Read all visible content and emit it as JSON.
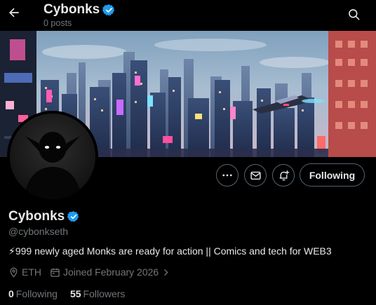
{
  "header": {
    "title": "Cybonks",
    "post_count": "0 posts"
  },
  "profile": {
    "name": "Cybonks",
    "handle": "@cybonkseth",
    "bio": "⚡999 newly aged Monks are ready for action || Comics and tech for WEB3",
    "location": "ETH",
    "joined": "Joined February 2026",
    "following_count": "0",
    "following_label": "Following",
    "followers_count": "55",
    "followers_label": "Followers",
    "follow_button_label": "Following"
  },
  "icons": {
    "back": "arrow-left-icon",
    "search": "search-icon",
    "more": "more-icon",
    "message": "envelope-icon",
    "notify": "bell-plus-icon",
    "verified": "verified-badge-icon",
    "location": "map-pin-icon",
    "calendar": "calendar-icon",
    "chevron": "chevron-right-icon"
  },
  "colors": {
    "background": "#000000",
    "text_primary": "#e7e9ea",
    "text_secondary": "#71767b",
    "verified_blue": "#1d9bf0",
    "border": "#536471"
  }
}
